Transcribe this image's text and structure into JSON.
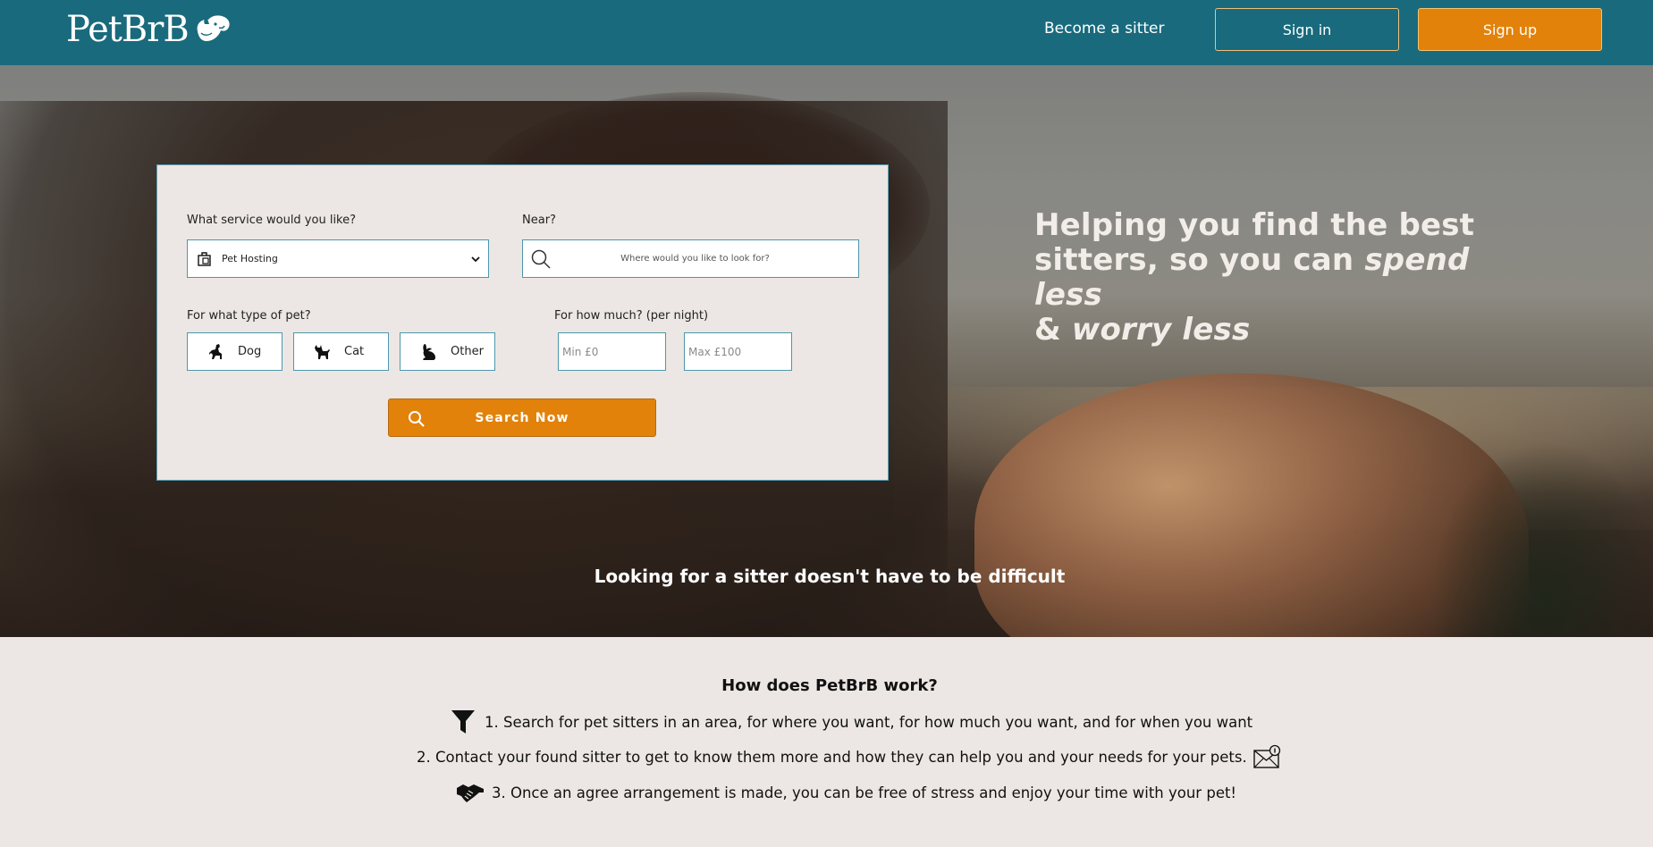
{
  "header": {
    "logo_text": "PetBrB",
    "logo_icon": "dog-cat-icon",
    "become_sitter": "Become a sitter",
    "sign_in": "Sign in",
    "sign_up": "Sign up",
    "brand_color": "#196a7d",
    "accent_color": "#e2820a"
  },
  "hero": {
    "tagline_line1": "Helping you find the best",
    "tagline_line2_start": "sitters, so you can ",
    "tagline_line2_em": "spend less",
    "tagline_line3_start": "& ",
    "tagline_line3_em": "worry less",
    "subtitle": "Looking for a sitter doesn't have to be difficult"
  },
  "search": {
    "service_label": "What service would you like?",
    "service_value": "Pet Hosting",
    "near_label": "Near?",
    "near_placeholder": "Where would you like to look for?",
    "pet_label": "For what type of pet?",
    "pets": [
      {
        "label": "Dog",
        "icon": "dog-icon"
      },
      {
        "label": "Cat",
        "icon": "cat-icon"
      },
      {
        "label": "Other",
        "icon": "rabbit-icon"
      }
    ],
    "price_label": "For how much? (per night)",
    "min_placeholder": "Min £0",
    "max_placeholder": "Max £100",
    "search_button": "Search Now"
  },
  "how": {
    "title": "How does PetBrB work?",
    "steps": [
      {
        "text": "1. Search for pet sitters in an area, for where you want, for how much you want, and for when you want",
        "icon": "filter-icon"
      },
      {
        "text": "2. Contact your found sitter to get to know them more and how they can help you and your needs for your pets.",
        "icon": "mail-notification-icon"
      },
      {
        "text": "3. Once an agree arrangement is made, you can be free of stress and enjoy your time with your pet!",
        "icon": "handshake-icon"
      }
    ]
  }
}
